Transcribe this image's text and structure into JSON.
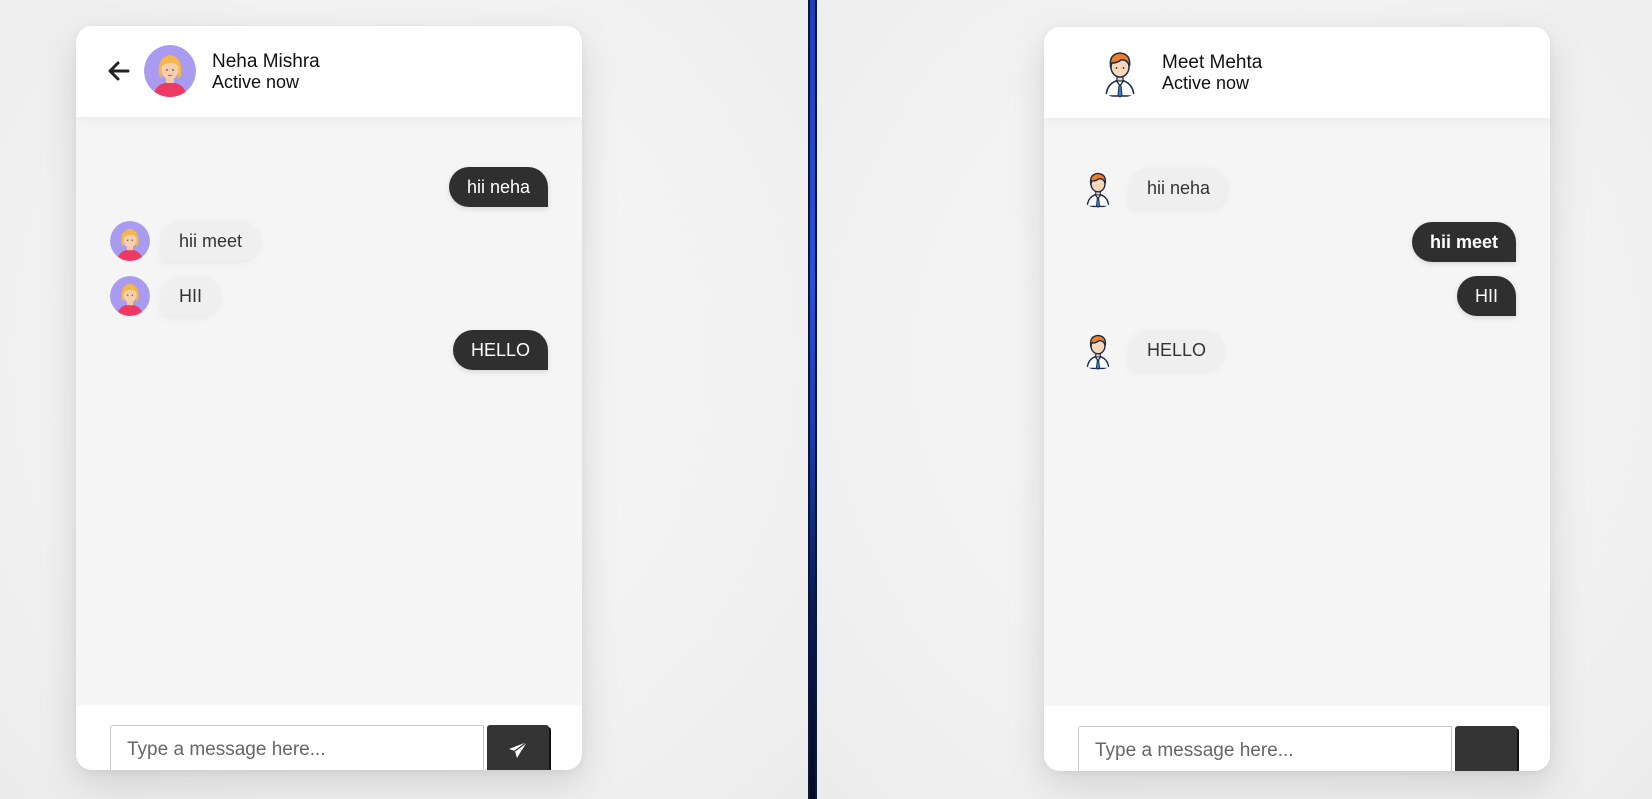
{
  "left_chat": {
    "contact_name": "Neha Mishra",
    "status": "Active now",
    "back_icon": "arrow-left-icon",
    "avatar": "female-avatar",
    "input_placeholder": "Type a message here...",
    "send_icon": "paper-plane-icon",
    "messages": [
      {
        "side": "sent",
        "text": "hii neha"
      },
      {
        "side": "received",
        "text": "hii meet"
      },
      {
        "side": "received",
        "text": "HII"
      },
      {
        "side": "sent",
        "text": "HELLO"
      }
    ]
  },
  "right_chat": {
    "contact_name": "Meet Mehta",
    "status": "Active now",
    "avatar": "male-avatar",
    "input_placeholder": "Type a message here...",
    "messages": [
      {
        "side": "received",
        "text": "hii neha"
      },
      {
        "side": "sent",
        "text": "hii meet"
      },
      {
        "side": "sent",
        "text": "HII"
      },
      {
        "side": "received",
        "text": "HELLO"
      }
    ]
  },
  "colors": {
    "sent_bubble": "#2f2f2f",
    "received_bubble": "#efefef",
    "divider": "#2a52d6",
    "send_button": "#343434"
  }
}
